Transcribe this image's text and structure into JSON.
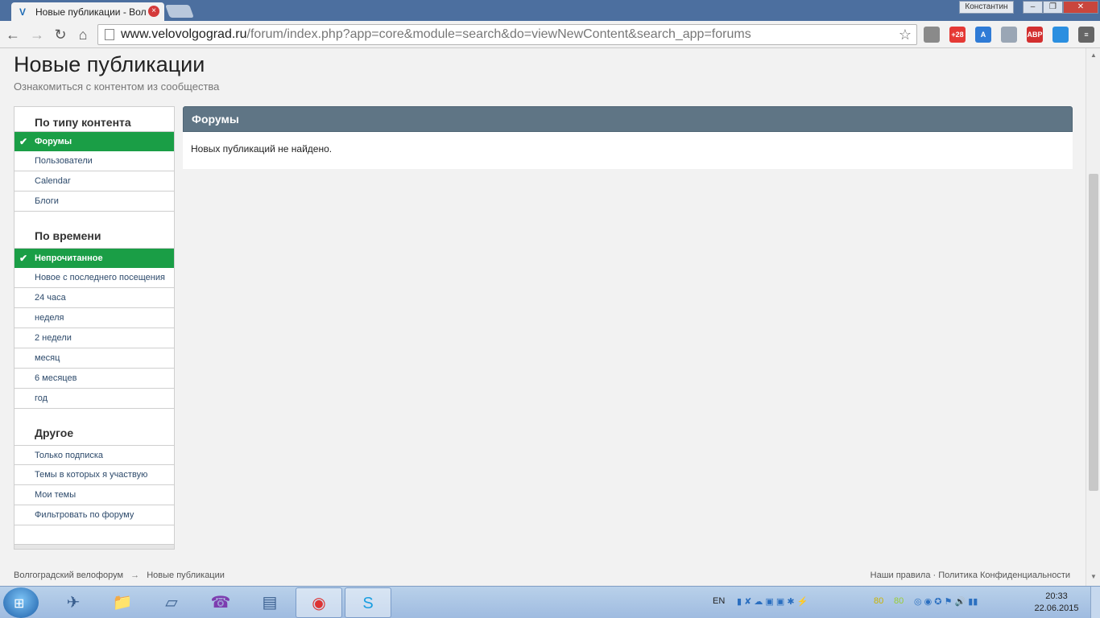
{
  "browser": {
    "tab_title": "Новые публикации - Вол",
    "tab_close": "×",
    "user_name": "Константин",
    "url_host": "www.velovolgograd.ru",
    "url_path": "/forum/index.php?app=core&module=search&do=viewNewContent&search_app=forums",
    "icons": [
      "back-icon",
      "forward-icon",
      "reload-icon",
      "home-icon",
      "star-icon"
    ],
    "extensions": [
      {
        "name": "mail-icon",
        "label": "",
        "color": "#8a8a8a"
      },
      {
        "name": "weather-icon",
        "label": "+28",
        "color": "#e53935"
      },
      {
        "name": "translate-icon",
        "label": "A",
        "color": "#2f7bd6"
      },
      {
        "name": "shield-icon",
        "label": "",
        "color": "#9aa6b5"
      },
      {
        "name": "adblock-icon",
        "label": "ABP",
        "color": "#d32f2f"
      },
      {
        "name": "cloud-icon",
        "label": "",
        "color": "#2b8fe0"
      },
      {
        "name": "menu-icon",
        "label": "≡",
        "color": "#666666"
      }
    ]
  },
  "page": {
    "title": "Новые публикации",
    "subtitle": "Ознакомиться с контентом из сообщества"
  },
  "sidebar": {
    "sections": [
      {
        "heading": "По типу контента",
        "items": [
          {
            "label": "Форумы",
            "active": true
          },
          {
            "label": "Пользователи",
            "active": false
          },
          {
            "label": "Calendar",
            "active": false
          },
          {
            "label": "Блоги",
            "active": false
          }
        ]
      },
      {
        "heading": "По времени",
        "items": [
          {
            "label": "Непрочитанное",
            "active": true
          },
          {
            "label": "Новое с последнего посещения",
            "active": false
          },
          {
            "label": "24 часа",
            "active": false
          },
          {
            "label": "неделя",
            "active": false
          },
          {
            "label": "2 недели",
            "active": false
          },
          {
            "label": "месяц",
            "active": false
          },
          {
            "label": "6 месяцев",
            "active": false
          },
          {
            "label": "год",
            "active": false
          }
        ]
      },
      {
        "heading": "Другое",
        "items": [
          {
            "label": "Только подписка",
            "active": false
          },
          {
            "label": "Темы в которых я участвую",
            "active": false
          },
          {
            "label": "Мои темы",
            "active": false
          },
          {
            "label": "Фильтровать по форуму",
            "active": false
          }
        ]
      }
    ],
    "check_mark": "✔"
  },
  "main": {
    "heading": "Форумы",
    "empty_message": "Новых публикаций не найдено."
  },
  "footer": {
    "breadcrumb_home": "Волгоградский велофорум",
    "breadcrumb_sep": "→",
    "breadcrumb_current": "Новые публикации",
    "rules": "Наши правила",
    "dot": "·",
    "privacy": "Политика Конфиденциальности"
  },
  "taskbar": {
    "language": "EN",
    "time": "20:33",
    "date": "22.06.2015",
    "tray_numbers": [
      "80",
      "80"
    ],
    "apps": [
      "launcher-icon",
      "explorer-icon",
      "notes-icon",
      "viber-icon",
      "monitor-icon",
      "chrome-icon",
      "skype-icon"
    ]
  }
}
